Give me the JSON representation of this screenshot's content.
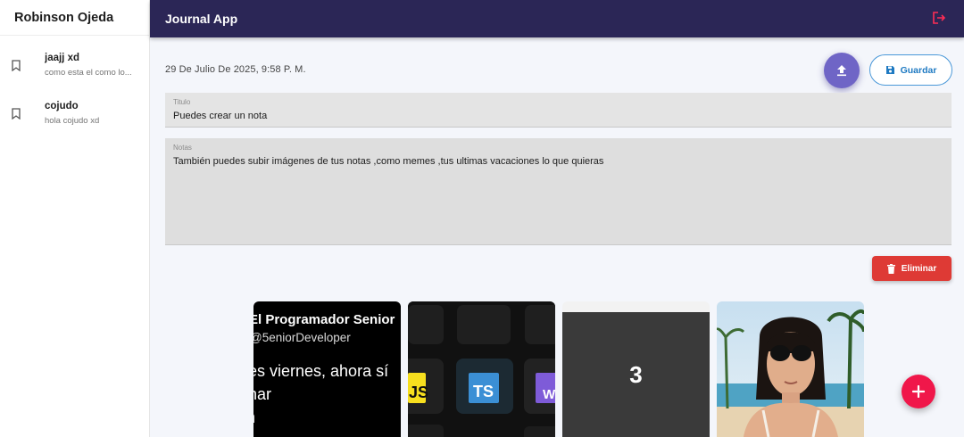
{
  "sidebar": {
    "user_name": "Robinson Ojeda",
    "notes": [
      {
        "title": "jaajj xd",
        "subtitle": "como esta el como lo..."
      },
      {
        "title": "cojudo",
        "subtitle": "hola cojudo xd"
      }
    ]
  },
  "topbar": {
    "title": "Journal App",
    "logout_icon": "logout-icon"
  },
  "note": {
    "date": "29 De Julio De 2025, 9:58 P. M.",
    "save_label": "Guardar",
    "title_label": "Titulo",
    "title_value": "Puedes crear un nota",
    "notes_label": "Notas",
    "notes_value": "También puedes subir imágenes de tus notas ,como memes ,tus ultimas vacaciones lo que quieras",
    "delete_label": "Eliminar"
  },
  "gallery": {
    "card1": {
      "line1": "El Programador Senior",
      "line2": "@5eniorDeveloper",
      "line3": "es viernes, ahora sí",
      "line4": "nar",
      "line5": "n"
    },
    "card2": {
      "badge_js": "JS",
      "badge_ts": "TS",
      "badge_w": "W"
    },
    "card3": {
      "number": "3"
    }
  },
  "colors": {
    "topbar": "#2b2656",
    "accent": "#6f65c6",
    "save_border": "#4a98d8",
    "delete": "#de3a35",
    "fab": "#f0174a"
  }
}
